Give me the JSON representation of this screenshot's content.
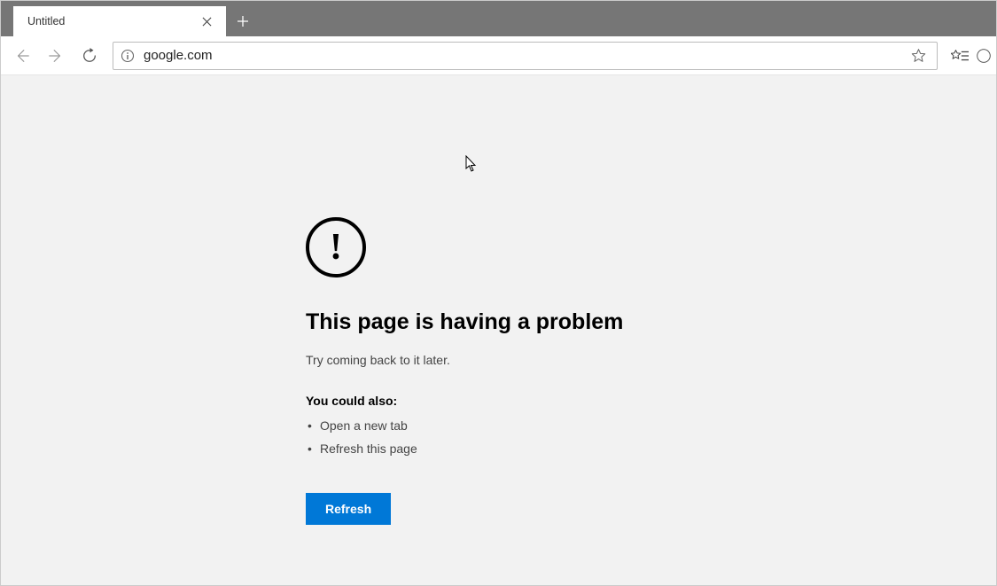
{
  "tab": {
    "title": "Untitled"
  },
  "address_bar": {
    "url": "google.com"
  },
  "error": {
    "heading": "This page is having a problem",
    "subtext": "Try coming back to it later.",
    "could_also_label": "You could also:",
    "suggestions": [
      "Open a new tab",
      "Refresh this page"
    ],
    "refresh_button": "Refresh"
  }
}
